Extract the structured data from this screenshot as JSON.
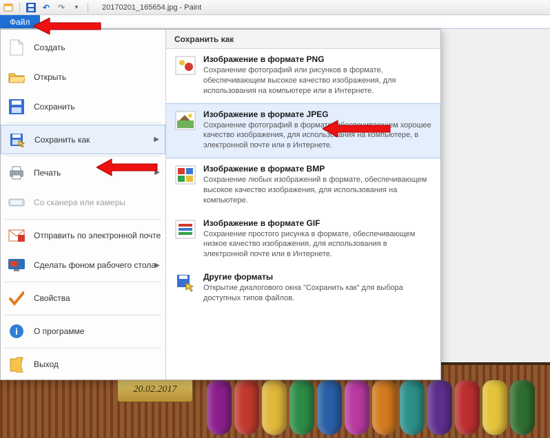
{
  "window": {
    "title": "20170201_165654.jpg - Paint"
  },
  "tabs": {
    "file": "Файл"
  },
  "menu": {
    "create": "Создать",
    "open": "Открыть",
    "save": "Сохранить",
    "saveas": "Сохранить как",
    "print": "Печать",
    "scanner": "Со сканера или камеры",
    "email": "Отправить по электронной почте",
    "wallpaper": "Сделать фоном рабочего стола",
    "props": "Свойства",
    "about": "О программе",
    "exit": "Выход"
  },
  "saveas_panel": {
    "header": "Сохранить как",
    "formats": [
      {
        "title": "Изображение в формате PNG",
        "desc": "Сохранение фотографий или рисунков в формате, обеспечивающем высокое качество изображения, для использования на компьютере или в Интернете."
      },
      {
        "title": "Изображение в формате JPEG",
        "desc": "Сохранение фотографий в формате, обеспечивающем хорошее качество изображения, для использования на компьютере, в электронной почте или в Интернете."
      },
      {
        "title": "Изображение в формате BMP",
        "desc": "Сохранение любых изображений в формате, обеспечивающем высокое качество изображения, для использования на компьютере."
      },
      {
        "title": "Изображение в формате GIF",
        "desc": "Сохранение простого рисунка в формате, обеспечивающем низкое качество изображения, для использования в электронной почте или в Интернете."
      },
      {
        "title": "Другие форматы",
        "desc": "Открытие диалогового окна \"Сохранить как\" для выбора доступных типов файлов."
      }
    ]
  },
  "plaque": "20.02.2017"
}
